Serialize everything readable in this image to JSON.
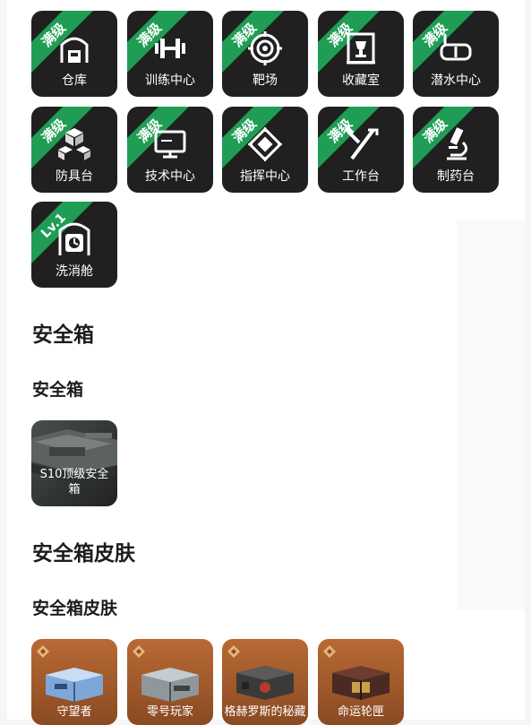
{
  "colors": {
    "badge_green": "#1f9d55",
    "tile_bg": "#202020",
    "skin_bg": "#b86a34"
  },
  "facilities": [
    {
      "badge": "满级",
      "label": "仓库",
      "icon": "warehouse-icon"
    },
    {
      "badge": "满级",
      "label": "训练中心",
      "icon": "dumbbell-icon"
    },
    {
      "badge": "满级",
      "label": "靶场",
      "icon": "target-icon"
    },
    {
      "badge": "满级",
      "label": "收藏室",
      "icon": "trophy-case-icon"
    },
    {
      "badge": "满级",
      "label": "潜水中心",
      "icon": "diving-mask-icon"
    },
    {
      "badge": "满级",
      "label": "防具台",
      "icon": "cubes-icon"
    },
    {
      "badge": "满级",
      "label": "技术中心",
      "icon": "monitor-icon"
    },
    {
      "badge": "满级",
      "label": "指挥中心",
      "icon": "chip-icon"
    },
    {
      "badge": "满级",
      "label": "工作台",
      "icon": "hammer-icon"
    },
    {
      "badge": "满级",
      "label": "制药台",
      "icon": "microscope-icon"
    },
    {
      "badge": "Lv.1",
      "label": "洗消舱",
      "icon": "decon-chamber-icon"
    }
  ],
  "safe_box": {
    "title": "安全箱",
    "subtitle": "安全箱",
    "items": [
      {
        "label": "S10顶级安全箱"
      }
    ]
  },
  "safe_box_skin": {
    "title": "安全箱皮肤",
    "subtitle": "安全箱皮肤",
    "items": [
      {
        "label": "守望者"
      },
      {
        "label": "零号玩家"
      },
      {
        "label": "格赫罗斯的秘藏"
      },
      {
        "label": "命运轮匣"
      }
    ]
  }
}
